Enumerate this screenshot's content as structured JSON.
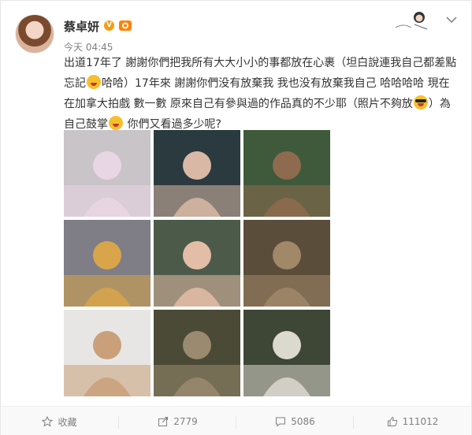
{
  "post": {
    "user_name": "蔡卓妍",
    "verified_badge": "V",
    "timestamp": "今天 04:45",
    "text_1": "出道17年了 謝謝你們把我所有大大小小的事都放在心裹（坦白說連我自己都差點忘記",
    "text_2": "哈哈）17年來 謝謝你們没有放棄我 我也没有放棄我自己 哈哈哈哈 現在在加拿大拍戲 數一數 原來自己有參與過的作品真的不少耶（照片不夠放",
    "text_3": "）為自己鼓掌",
    "text_4": " 你們又看過多少呢?"
  },
  "photos": [
    {
      "name": "photo-1",
      "bg": "#c9c4c8",
      "accent": "#e9d6e4"
    },
    {
      "name": "photo-2",
      "bg": "#2b3a3e",
      "accent": "#d9b9a5"
    },
    {
      "name": "photo-3",
      "bg": "#3f5a3a",
      "accent": "#8e6b4e"
    },
    {
      "name": "photo-4",
      "bg": "#7f7d86",
      "accent": "#d8a54a"
    },
    {
      "name": "photo-5",
      "bg": "#4c5a4a",
      "accent": "#e3bda6"
    },
    {
      "name": "photo-6",
      "bg": "#5a4d3a",
      "accent": "#a08868"
    },
    {
      "name": "photo-7",
      "bg": "#e8e6e5",
      "accent": "#c9a07a"
    },
    {
      "name": "photo-8",
      "bg": "#4b4a36",
      "accent": "#9a8a70"
    },
    {
      "name": "photo-9",
      "bg": "#3e4636",
      "accent": "#dcd9cf"
    }
  ],
  "actions": {
    "favorite_label": "收藏",
    "share_count": "2779",
    "comment_count": "5086",
    "like_count": "111012"
  },
  "icons": {
    "favorite": "star-icon",
    "share": "share-icon",
    "comment": "comment-icon",
    "like": "thumbs-up-icon",
    "menu": "chevron-down-icon"
  },
  "colors": {
    "accent_orange": "#ff8200",
    "verified_gold": "#f59d10",
    "muted": "#808080"
  }
}
